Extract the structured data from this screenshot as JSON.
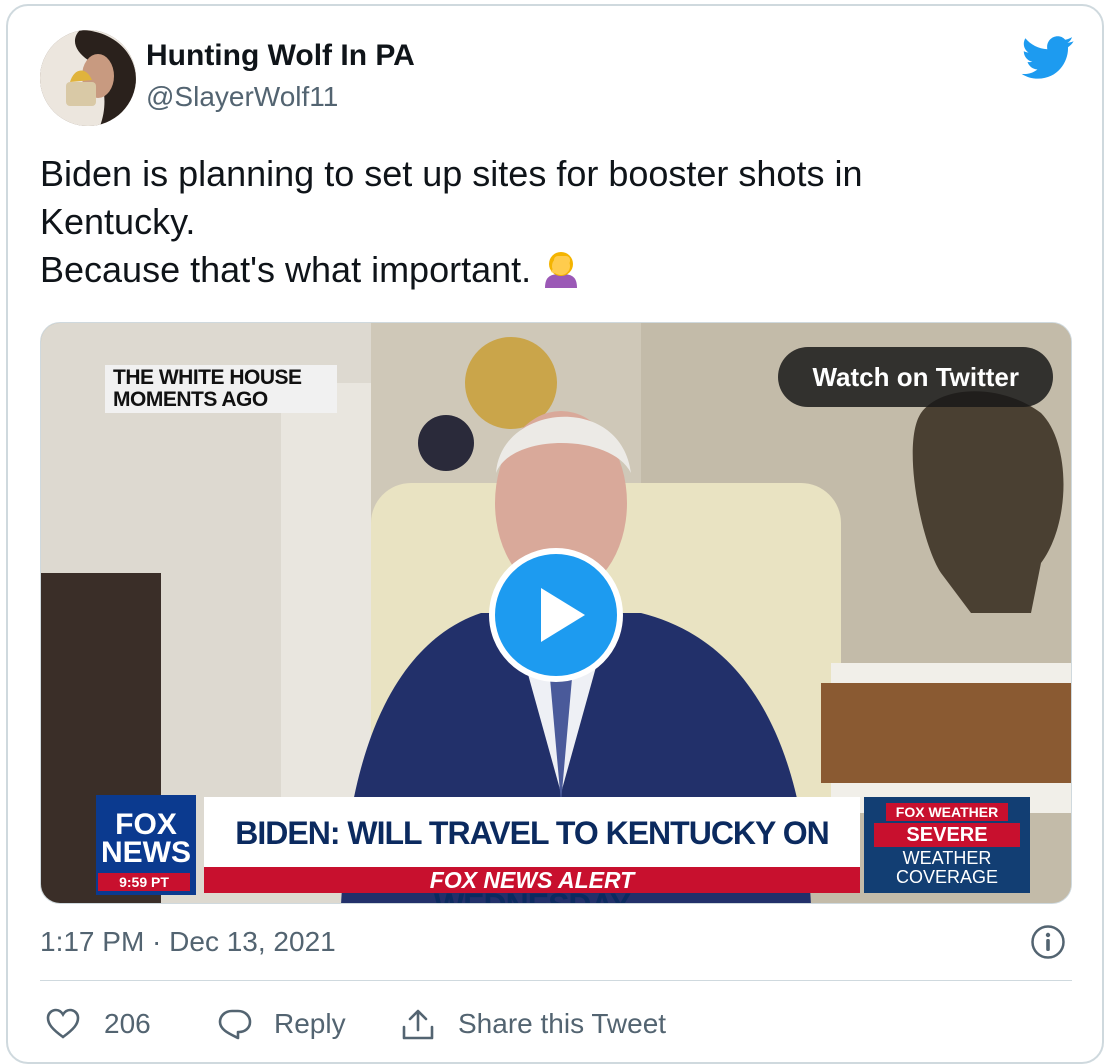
{
  "author": {
    "display_name": "Hunting Wolf In PA",
    "handle": "@SlayerWolf11"
  },
  "icons": {
    "platform": "twitter-bird-icon",
    "emoji": "woman-facepalming-emoji",
    "info": "info-icon",
    "like": "heart-icon",
    "reply": "speech-bubble-icon",
    "share": "share-upload-icon"
  },
  "colors": {
    "accent": "#1d9bf0",
    "text_primary": "#0f1419",
    "text_secondary": "#536471"
  },
  "tweet": {
    "line1": "Biden is planning to set up sites for booster shots in",
    "line2": "Kentucky.",
    "line3": "Because that's what important."
  },
  "video": {
    "watch_label": "Watch on Twitter",
    "slug_line1": "THE WHITE HOUSE",
    "slug_line2": "MOMENTS AGO",
    "logo_line1": "FOX",
    "logo_line2": "NEWS",
    "logo_time": "9:59 PT",
    "headline": "BIDEN: WILL TRAVEL TO KENTUCKY ON WEDNESDAY",
    "alert": "FOX NEWS ALERT",
    "weather_tag": "FOX WEATHER",
    "weather_severe": "SEVERE",
    "weather_line2": "WEATHER",
    "weather_line3": "COVERAGE"
  },
  "meta": {
    "timestamp": "1:17 PM · Dec 13, 2021"
  },
  "actions": {
    "likes": "206",
    "reply": "Reply",
    "share": "Share this Tweet"
  }
}
